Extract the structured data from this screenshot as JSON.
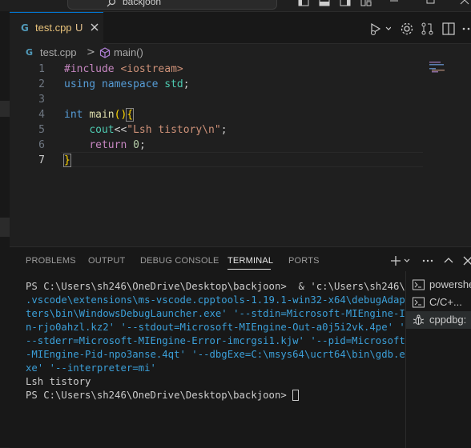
{
  "titlebar": {
    "search_text": "backjoon"
  },
  "tab": {
    "icon": "C++",
    "filename": "test.cpp",
    "status": "U"
  },
  "breadcrumb": {
    "file": "test.cpp",
    "separator": ">",
    "symbol": "main()"
  },
  "editor": {
    "line_numbers": [
      "1",
      "2",
      "3",
      "4",
      "5",
      "6",
      "7"
    ],
    "active_line": 7
  },
  "panel": {
    "tabs": [
      "PROBLEMS",
      "OUTPUT",
      "DEBUG CONSOLE",
      "TERMINAL",
      "PORTS"
    ],
    "active_tab": "TERMINAL",
    "terminal_lines": [
      "PS C:\\Users\\sh246\\OneDrive\\Desktop\\backjoon>  & 'c:\\Users\\sh246\\",
      ".vscode\\extensions\\ms-vscode.cpptools-1.19.1-win32-x64\\debugAdap",
      "ters\\bin\\WindowsDebugLauncher.exe' '--stdin=Microsoft-MIEngine-I",
      "n-rjo0ahzl.kz2' '--stdout=Microsoft-MIEngine-Out-a0j5i2vk.4pe' '",
      "--stderr=Microsoft-MIEngine-Error-imcrgsi1.kjw' '--pid=Microsoft",
      "-MIEngine-Pid-npo3anse.4qt' '--dbgExe=C:\\msys64\\ucrt64\\bin\\gdb.e",
      "xe' '--interpreter=mi'",
      "Lsh tistory",
      "PS C:\\Users\\sh246\\OneDrive\\Desktop\\backjoon> "
    ],
    "terminal_list": [
      {
        "label": "powershe",
        "icon": "terminal-powershell-icon"
      },
      {
        "label": "C/C+...",
        "icon": "terminal-icon"
      },
      {
        "label": "cppdbg: ",
        "icon": "debug-icon"
      }
    ]
  },
  "colors": {
    "accent": "#0078d4",
    "keyword": "#569cd6",
    "string": "#ce9178",
    "function": "#dcdcaa",
    "modified": "#e2c08d"
  }
}
